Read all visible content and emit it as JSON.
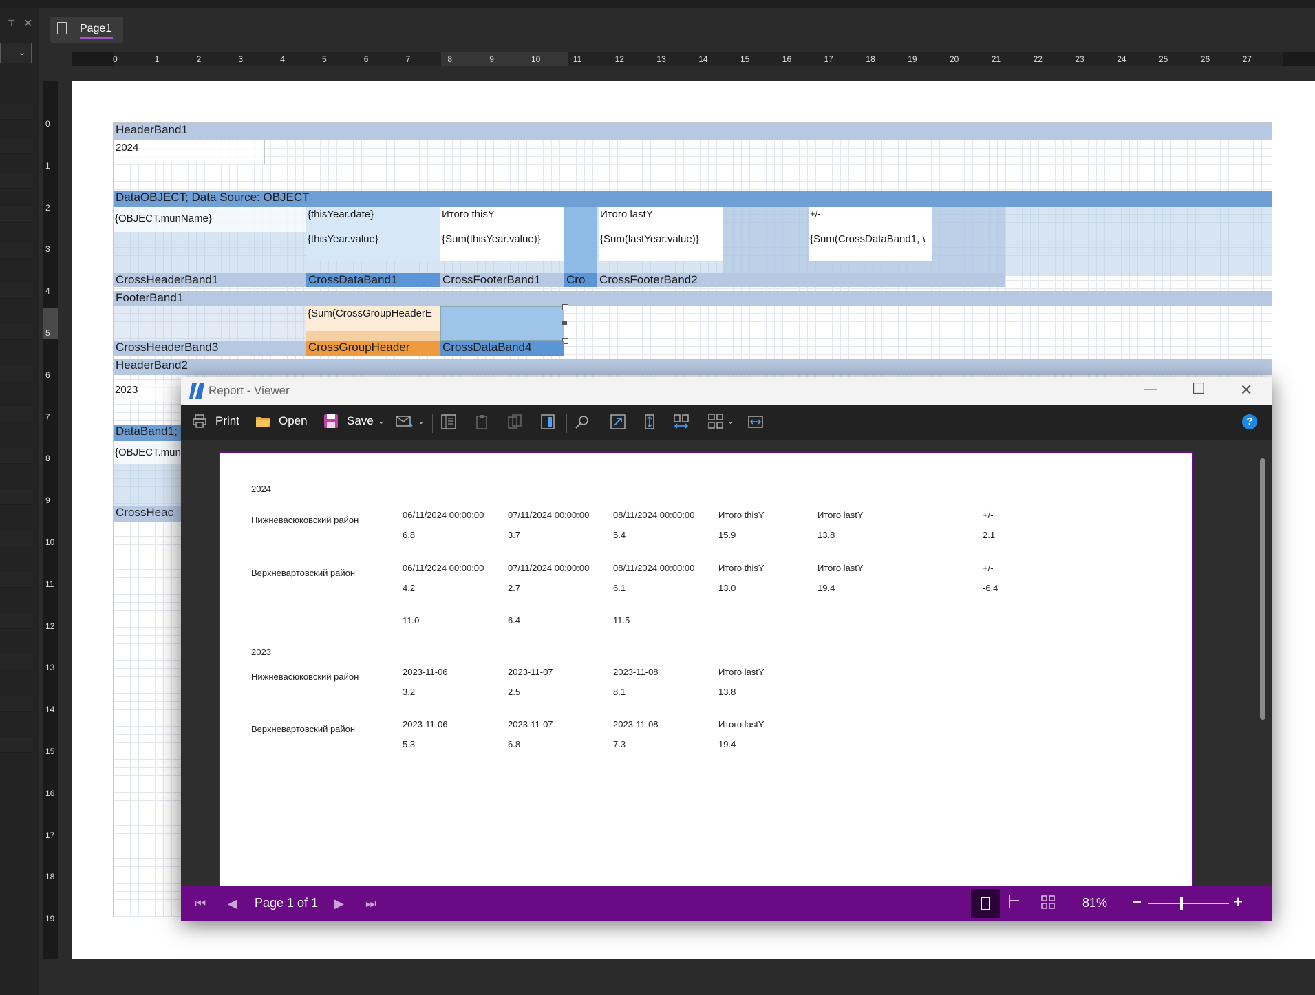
{
  "designer": {
    "tab_label": "Page1",
    "hruler": [
      "0",
      "1",
      "2",
      "3",
      "4",
      "5",
      "6",
      "7",
      "8",
      "9",
      "10",
      "11",
      "12",
      "13",
      "14",
      "15",
      "16",
      "17",
      "18",
      "19",
      "20",
      "21",
      "22",
      "23",
      "24",
      "25",
      "26",
      "27"
    ],
    "vruler": [
      "0",
      "1",
      "2",
      "3",
      "4",
      "5",
      "6",
      "7",
      "8",
      "9",
      "10",
      "11",
      "12",
      "13",
      "14",
      "15",
      "16",
      "17",
      "18",
      "19"
    ],
    "bands": {
      "header1": "HeaderBand1",
      "header1_value": "2024",
      "data1": "DataOBJECT; Data Source: OBJECT",
      "mun_name": "{OBJECT.munName}",
      "this_year_date": "{thisYear.date}",
      "this_year_value": "{thisYear.value}",
      "itogo_this": "Итого thisY",
      "sum_this": "{Sum(thisYear.value)}",
      "itogo_last": "Итого lastY",
      "sum_last": "{Sum(lastYear.value)}",
      "plus_minus": "+/-",
      "sum_cross": "{Sum(CrossDataBand1, \\",
      "cross_header1": "CrossHeaderBand1",
      "cross_data1": "CrossDataBand1",
      "cross_footer1": "CrossFooterBand1",
      "cro": "Cro",
      "cross_footer2": "CrossFooterBand2",
      "footer1": "FooterBand1",
      "sum_group": "{Sum(CrossGroupHeaderE",
      "cross_header3": "CrossHeaderBand3",
      "cross_group": "CrossGroupHeader",
      "cross_data4": "CrossDataBand4",
      "header2": "HeaderBand2",
      "header2_value": "2023",
      "data2": "DataBand1;",
      "mun_name2": "{OBJECT.mun",
      "cross_head_partial": "CrossHeac"
    }
  },
  "viewer": {
    "title": "Report - Viewer",
    "toolbar": {
      "print": "Print",
      "open": "Open",
      "save": "Save"
    },
    "status": {
      "page": "Page 1 of 1",
      "zoom": "81%"
    },
    "report": {
      "year1": "2024",
      "block1": {
        "row1_name": "Нижневасюковский район",
        "row1_heads": [
          "06/11/2024 00:00:00",
          "07/11/2024 00:00:00",
          "08/11/2024 00:00:00",
          "Итого thisY",
          "Итого lastY",
          "+/-"
        ],
        "row1_vals": [
          "6.8",
          "3.7",
          "5.4",
          "15.9",
          "13.8",
          "2.1"
        ],
        "row2_name": "Верхневартовский район",
        "row2_heads": [
          "06/11/2024 00:00:00",
          "07/11/2024 00:00:00",
          "08/11/2024 00:00:00",
          "Итого thisY",
          "Итого lastY",
          "+/-"
        ],
        "row2_vals": [
          "4.2",
          "2.7",
          "6.1",
          "13.0",
          "19.4",
          "-6.4"
        ],
        "totals": [
          "11.0",
          "6.4",
          "11.5"
        ]
      },
      "year2": "2023",
      "block2": {
        "row1_name": "Нижневасюковский район",
        "row1_heads": [
          "2023-11-06",
          "2023-11-07",
          "2023-11-08",
          "Итого lastY"
        ],
        "row1_vals": [
          "3.2",
          "2.5",
          "8.1",
          "13.8"
        ],
        "row2_name": "Верхневартовский район",
        "row2_heads": [
          "2023-11-06",
          "2023-11-07",
          "2023-11-08",
          "Итого lastY"
        ],
        "row2_vals": [
          "5.3",
          "6.8",
          "7.3",
          "19.4"
        ]
      }
    }
  }
}
